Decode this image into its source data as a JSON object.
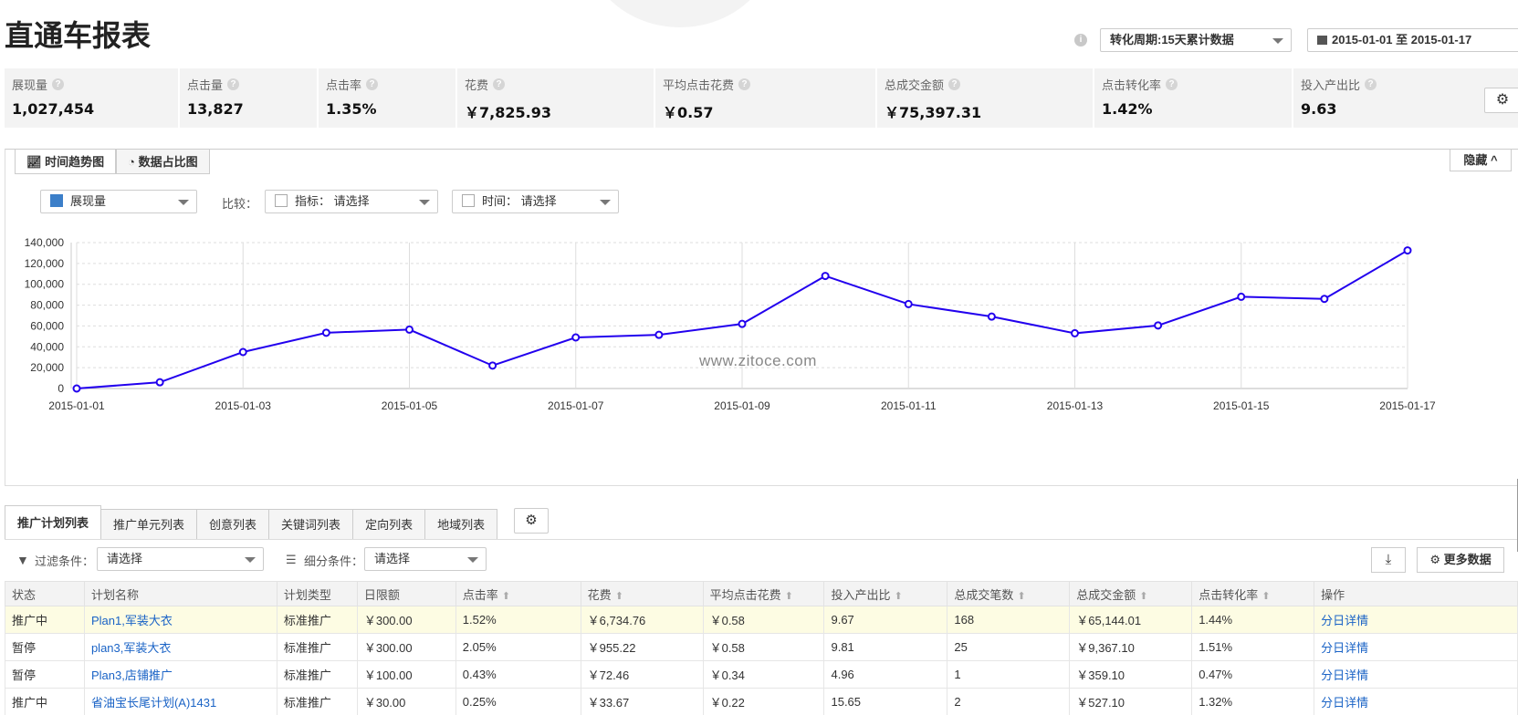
{
  "page": {
    "title": "直通车报表"
  },
  "header": {
    "cycle_label": "转化周期:15天累计数据",
    "date_range": "2015-01-01 至 2015-01-17"
  },
  "metrics": [
    {
      "label": "展现量",
      "value": "1,027,454"
    },
    {
      "label": "点击量",
      "value": "13,827"
    },
    {
      "label": "点击率",
      "value": "1.35%"
    },
    {
      "label": "花费",
      "value": "￥7,825.93"
    },
    {
      "label": "平均点击花费",
      "value": "￥0.57"
    },
    {
      "label": "总成交金额",
      "value": "￥75,397.31"
    },
    {
      "label": "点击转化率",
      "value": "1.42%"
    },
    {
      "label": "投入产出比",
      "value": "9.63"
    }
  ],
  "chart_tabs": {
    "trend": "时间趋势图",
    "ratio": "数据占比图",
    "hide": "隐藏"
  },
  "chart_controls": {
    "metric": "展现量",
    "compare_label": "比较：",
    "indicator": "指标： 请选择",
    "time": "时间： 请选择"
  },
  "watermark": "www.zitoce.com",
  "chart_data": {
    "type": "line",
    "x": [
      "2015-01-01",
      "2015-01-02",
      "2015-01-03",
      "2015-01-04",
      "2015-01-05",
      "2015-01-06",
      "2015-01-07",
      "2015-01-08",
      "2015-01-09",
      "2015-01-10",
      "2015-01-11",
      "2015-01-12",
      "2015-01-13",
      "2015-01-14",
      "2015-01-15",
      "2015-01-16",
      "2015-01-17"
    ],
    "x_ticks": [
      "2015-01-01",
      "2015-01-03",
      "2015-01-05",
      "2015-01-07",
      "2015-01-09",
      "2015-01-11",
      "2015-01-13",
      "2015-01-15",
      "2015-01-17"
    ],
    "y_ticks": [
      "0",
      "20,000",
      "40,000",
      "60,000",
      "80,000",
      "100,000",
      "120,000",
      "140,000"
    ],
    "series": [
      {
        "name": "展现量",
        "color": "#2200ee",
        "values": [
          0,
          6000,
          35000,
          53500,
          56500,
          22000,
          49000,
          51500,
          62000,
          108000,
          81000,
          69000,
          53000,
          60500,
          88000,
          86000,
          132500
        ]
      }
    ],
    "ylim": [
      0,
      140000
    ],
    "grid": true,
    "title": "",
    "xlabel": "",
    "ylabel": ""
  },
  "list_tabs": [
    "推广计划列表",
    "推广单元列表",
    "创意列表",
    "关键词列表",
    "定向列表",
    "地域列表"
  ],
  "filters": {
    "filter_label": "过滤条件：",
    "filter_value": "请选择",
    "sub_label": "细分条件：",
    "sub_value": "请选择",
    "more_data": "更多数据"
  },
  "table": {
    "headers": [
      "状态",
      "计划名称",
      "计划类型",
      "日限额",
      "点击率",
      "花费",
      "平均点击花费",
      "投入产出比",
      "总成交笔数",
      "总成交金额",
      "点击转化率",
      "操作"
    ],
    "rows": [
      [
        "推广中",
        "Plan1,军装大衣",
        "标准推广",
        "￥300.00",
        "1.52%",
        "￥6,734.76",
        "￥0.58",
        "9.67",
        "168",
        "￥65,144.01",
        "1.44%",
        "分日详情"
      ],
      [
        "暂停",
        "plan3,军装大衣",
        "标准推广",
        "￥300.00",
        "2.05%",
        "￥955.22",
        "￥0.58",
        "9.81",
        "25",
        "￥9,367.10",
        "1.51%",
        "分日详情"
      ],
      [
        "暂停",
        "Plan3,店铺推广",
        "标准推广",
        "￥100.00",
        "0.43%",
        "￥72.46",
        "￥0.34",
        "4.96",
        "1",
        "￥359.10",
        "0.47%",
        "分日详情"
      ],
      [
        "推广中",
        "省油宝长尾计划(A)1431",
        "标准推广",
        "￥30.00",
        "0.25%",
        "￥33.67",
        "￥0.22",
        "15.65",
        "2",
        "￥527.10",
        "1.32%",
        "分日详情"
      ]
    ]
  }
}
